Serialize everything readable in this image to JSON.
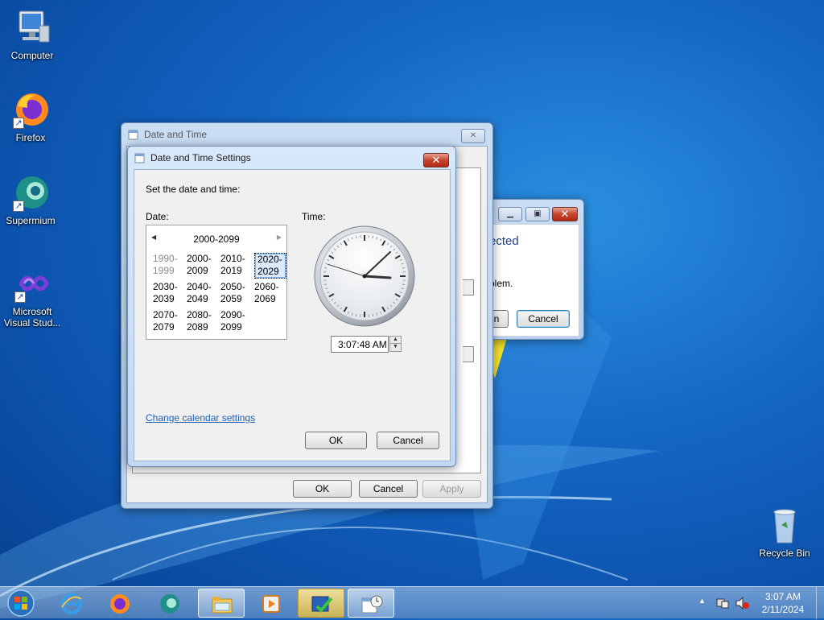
{
  "desktop": {
    "icons": [
      {
        "label": "Computer",
        "icon": "computer-icon"
      },
      {
        "label": "Firefox",
        "icon": "firefox-icon"
      },
      {
        "label": "Supermium",
        "icon": "supermium-icon"
      },
      {
        "label": "Microsoft Visual Stud...",
        "icon": "visual-studio-icon"
      },
      {
        "label": "Recycle Bin",
        "icon": "recycle-bin-icon"
      }
    ]
  },
  "outer_window": {
    "title": "Date and Time",
    "ok_label": "OK",
    "cancel_label": "Cancel",
    "apply_label": "Apply"
  },
  "background_window": {
    "partial_heading": "ected",
    "partial_text": "blem.",
    "partial_button": "n",
    "cancel_label": "Cancel"
  },
  "dialog": {
    "title": "Date and Time Settings",
    "instruction": "Set the date and time:",
    "date_label": "Date:",
    "time_label": "Time:",
    "calendar": {
      "header": "2000-2099",
      "prev_arrow": "◀",
      "next_arrow": "▶",
      "decades": [
        {
          "top": "1990-",
          "bottom": "1999",
          "state": "gray"
        },
        {
          "top": "2000-",
          "bottom": "2009",
          "state": "normal"
        },
        {
          "top": "2010-",
          "bottom": "2019",
          "state": "normal"
        },
        {
          "top": "2020-",
          "bottom": "2029",
          "state": "selected"
        },
        {
          "top": "2030-",
          "bottom": "2039",
          "state": "normal"
        },
        {
          "top": "2040-",
          "bottom": "2049",
          "state": "normal"
        },
        {
          "top": "2050-",
          "bottom": "2059",
          "state": "normal"
        },
        {
          "top": "2060-",
          "bottom": "2069",
          "state": "normal"
        },
        {
          "top": "2070-",
          "bottom": "2079",
          "state": "normal"
        },
        {
          "top": "2080-",
          "bottom": "2089",
          "state": "normal"
        },
        {
          "top": "2090-",
          "bottom": "2099",
          "state": "normal"
        }
      ]
    },
    "time_value": "3:07:48 AM",
    "clock": {
      "hours": 3,
      "minutes": 7,
      "seconds": 48
    },
    "change_calendar_link": "Change calendar settings",
    "ok_label": "OK",
    "cancel_label": "Cancel"
  },
  "taskbar": {
    "items": [
      {
        "icon": "start-orb-icon"
      },
      {
        "icon": "internet-explorer-icon"
      },
      {
        "icon": "firefox-icon"
      },
      {
        "icon": "supermium-icon"
      },
      {
        "icon": "file-explorer-icon"
      },
      {
        "icon": "media-player-icon"
      },
      {
        "icon": "action-center-icon"
      },
      {
        "icon": "date-time-app-icon"
      }
    ],
    "tray": {
      "time": "3:07 AM",
      "date": "2/11/2024"
    }
  },
  "colors": {
    "link": "#1a5fb4",
    "close_button": "#c6452e",
    "desktop_blue": "#1466c4"
  }
}
